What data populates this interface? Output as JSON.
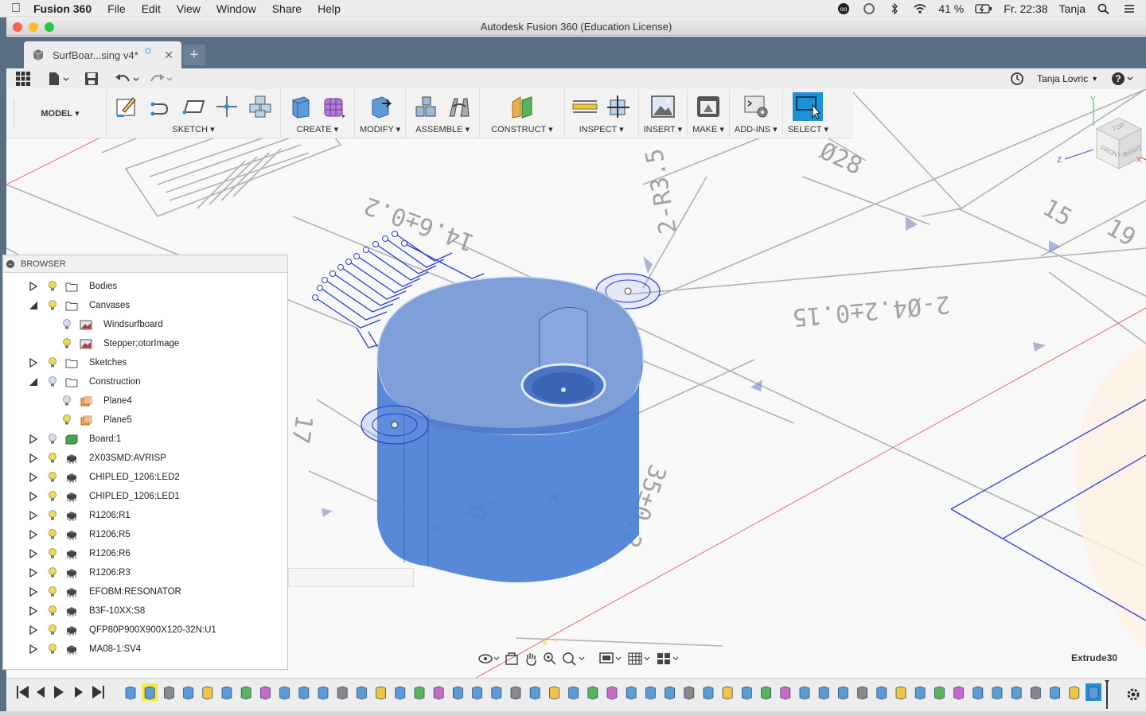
{
  "menubar": {
    "app_name": "Fusion 360",
    "items": [
      "File",
      "Edit",
      "View",
      "Window",
      "Share",
      "Help"
    ],
    "battery": "41 %",
    "clock": "Fr. 22:38",
    "user": "Tanja"
  },
  "window": {
    "title": "Autodesk Fusion 360 (Education License)"
  },
  "tabs": [
    {
      "label": "SurfBoar...sing v4*"
    }
  ],
  "quick_access": {
    "user_name": "Tanja Lovric"
  },
  "ribbon": {
    "workspace": "MODEL",
    "groups": [
      {
        "label": "SKETCH",
        "icons": [
          "sketch-create-icon",
          "line-icon",
          "rectangle-icon",
          "point-icon",
          "project-icon"
        ]
      },
      {
        "label": "CREATE",
        "icons": [
          "extrude-icon",
          "form-icon"
        ]
      },
      {
        "label": "MODIFY",
        "icons": [
          "press-pull-icon"
        ]
      },
      {
        "label": "ASSEMBLE",
        "icons": [
          "new-component-icon",
          "joint-icon"
        ]
      },
      {
        "label": "CONSTRUCT",
        "icons": [
          "offset-plane-icon"
        ]
      },
      {
        "label": "INSPECT",
        "icons": [
          "measure-icon",
          "section-analysis-icon"
        ]
      },
      {
        "label": "INSERT",
        "icons": [
          "insert-image-icon"
        ]
      },
      {
        "label": "MAKE",
        "icons": [
          "3d-print-icon"
        ]
      },
      {
        "label": "ADD-INS",
        "icons": [
          "scripts-icon"
        ]
      },
      {
        "label": "SELECT",
        "icons": [
          "select-icon"
        ]
      }
    ]
  },
  "browser": {
    "title": "BROWSER",
    "items": [
      {
        "label": "Bodies",
        "level": 0,
        "expanded": false,
        "icon": "folder"
      },
      {
        "label": "Canvases",
        "level": 0,
        "expanded": true,
        "icon": "folder"
      },
      {
        "label": "Windsurfboard",
        "level": 1,
        "icon": "canvas"
      },
      {
        "label": "Stepper;otorImage",
        "level": 1,
        "icon": "canvas"
      },
      {
        "label": "Sketches",
        "level": 0,
        "expanded": false,
        "icon": "folder"
      },
      {
        "label": "Construction",
        "level": 0,
        "expanded": true,
        "icon": "folder"
      },
      {
        "label": "Plane4",
        "level": 1,
        "icon": "plane"
      },
      {
        "label": "Plane5",
        "level": 1,
        "icon": "plane"
      },
      {
        "label": "Board:1",
        "level": 0,
        "expanded": false,
        "icon": "board"
      },
      {
        "label": "2X03SMD:AVRISP",
        "level": 0,
        "expanded": false,
        "icon": "component"
      },
      {
        "label": "CHIPLED_1206:LED2",
        "level": 0,
        "expanded": false,
        "icon": "component"
      },
      {
        "label": "CHIPLED_1206:LED1",
        "level": 0,
        "expanded": false,
        "icon": "component"
      },
      {
        "label": "R1206:R1",
        "level": 0,
        "expanded": false,
        "icon": "component"
      },
      {
        "label": "R1206:R5",
        "level": 0,
        "expanded": false,
        "icon": "component"
      },
      {
        "label": "R1206:R6",
        "level": 0,
        "expanded": false,
        "icon": "component"
      },
      {
        "label": "R1206:R3",
        "level": 0,
        "expanded": false,
        "icon": "component"
      },
      {
        "label": "EFOBM:RESONATOR",
        "level": 0,
        "expanded": false,
        "icon": "component"
      },
      {
        "label": "B3F-10XX:S8",
        "level": 0,
        "expanded": false,
        "icon": "component"
      },
      {
        "label": "QFP80P900X900X120-32N:U1",
        "level": 0,
        "expanded": false,
        "icon": "component"
      },
      {
        "label": "MA08-1:SV4",
        "level": 0,
        "expanded": false,
        "icon": "component"
      }
    ]
  },
  "viewport": {
    "drawing_text": [
      "14.6±0.2",
      "2-R3.5",
      "Ø28",
      "15",
      "19",
      "2-Ø4.2±0.15",
      "35±0.2",
      "17",
      "8"
    ],
    "viewcube": {
      "top": "TOP",
      "front": "FRONT",
      "right": "RIGHT",
      "axes": [
        "Y",
        "Z",
        "X"
      ]
    },
    "feature_label": "Extrude30"
  },
  "colors": {
    "accent": "#1f8fd6",
    "body": "#4a7fd6",
    "tabbar": "#5a6f84"
  }
}
